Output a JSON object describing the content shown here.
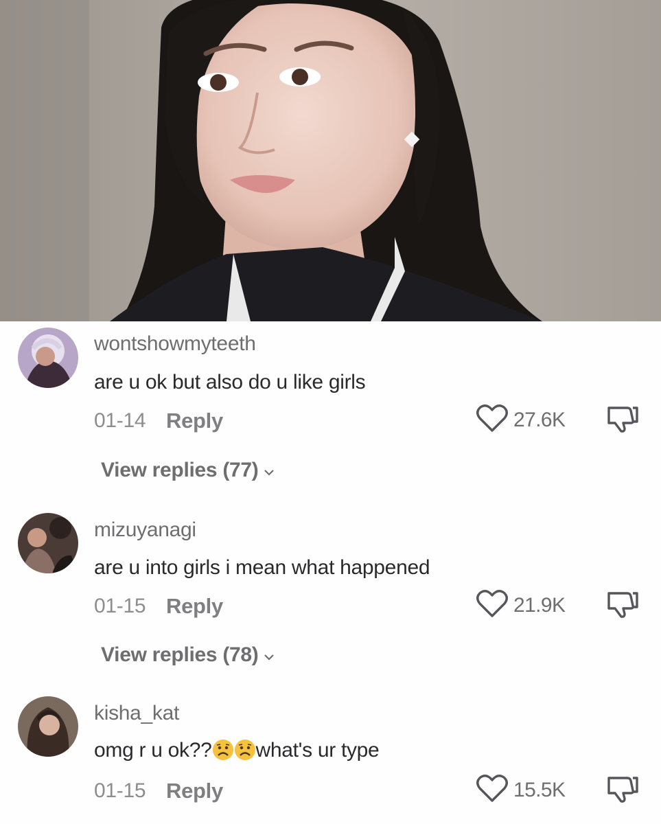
{
  "photo": {
    "description_icon": "video-still"
  },
  "comments": [
    {
      "username": "wontshowmyteeth",
      "text": "are u ok but also do u like girls",
      "date": "01-14",
      "reply_label": "Reply",
      "likes": "27.6K",
      "view_replies": "View replies (77)"
    },
    {
      "username": "mizuyanagi",
      "text": "are u into girls i mean what happened",
      "date": "01-15",
      "reply_label": "Reply",
      "likes": "21.9K",
      "view_replies": "View replies (78)"
    },
    {
      "username": "kisha_kat",
      "text_before": "omg r u ok??",
      "text_after": "what's ur type",
      "emoji": [
        "frowning-face-emoji",
        "frowning-face-emoji"
      ],
      "date": "01-15",
      "reply_label": "Reply",
      "likes": "15.5K"
    }
  ],
  "icons": {
    "like": "heart-outline-icon",
    "dislike": "thumbs-down-icon",
    "expand": "chevron-down-icon"
  },
  "colors": {
    "username": "#6e6e70",
    "text": "#2a2a2c",
    "meta": "#8d8d90",
    "background": "#fefefe",
    "emoji": "#f6c23e"
  }
}
